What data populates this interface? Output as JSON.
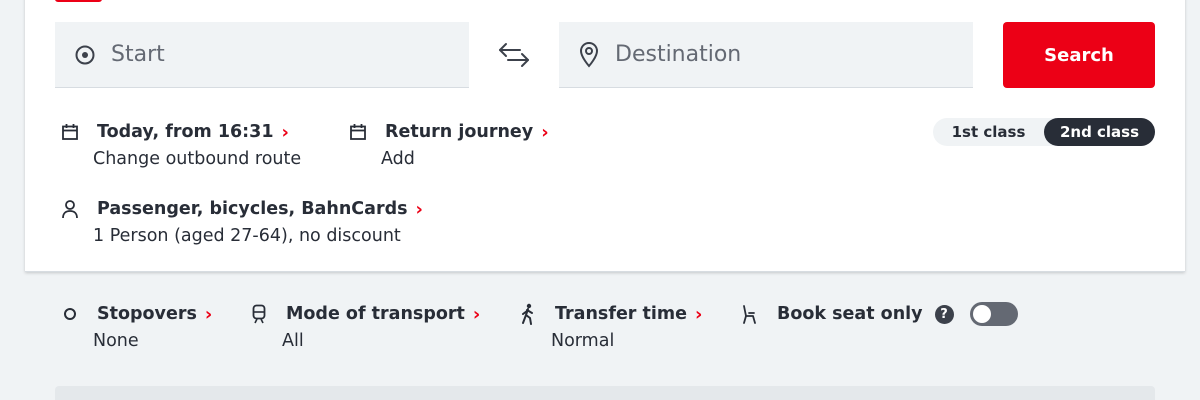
{
  "search": {
    "start_placeholder": "Start",
    "destination_placeholder": "Destination",
    "search_label": "Search",
    "swap_icon": "swap-arrows-icon"
  },
  "journey": {
    "outbound": {
      "title": "Today, from 16:31",
      "subtitle": "Change outbound route",
      "icon": "calendar-icon"
    },
    "return": {
      "title": "Return journey",
      "subtitle": "Add",
      "icon": "calendar-icon"
    },
    "passengers": {
      "title": "Passenger, bicycles, BahnCards",
      "subtitle": "1 Person (aged 27-64), no discount",
      "icon": "person-icon"
    }
  },
  "travel_class": {
    "options": [
      "1st class",
      "2nd class"
    ],
    "selected": "2nd class"
  },
  "filters": {
    "stopovers": {
      "title": "Stopovers",
      "value": "None",
      "icon": "circle-icon"
    },
    "mode": {
      "title": "Mode of transport",
      "value": "All",
      "icon": "train-icon"
    },
    "transfer": {
      "title": "Transfer time",
      "value": "Normal",
      "icon": "walking-icon"
    },
    "seat": {
      "title": "Book seat only",
      "help": "?",
      "toggle_on": false,
      "icon": "seat-icon"
    }
  },
  "colors": {
    "brand_red": "#ec0016",
    "dark": "#282d37",
    "field_bg": "#f0f3f5"
  }
}
